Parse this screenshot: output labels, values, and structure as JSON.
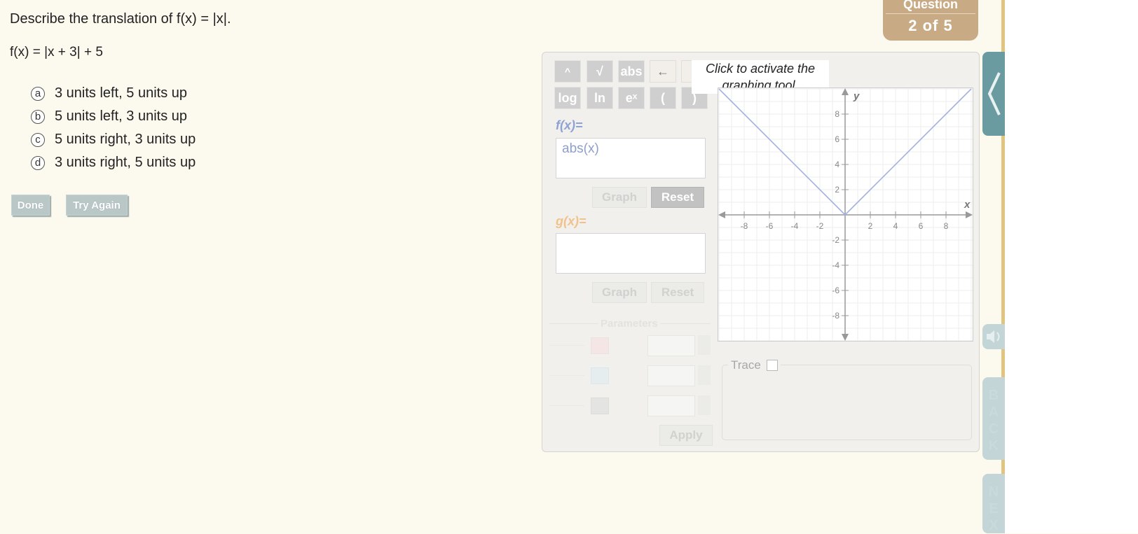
{
  "question": {
    "prompt_prefix": "Describe the translation of ",
    "prompt_fx": "f(x) = |x|.",
    "function_text": "f(x) = |x + 3| + 5",
    "choices": [
      {
        "letter": "a",
        "text": "3 units left, 5 units up"
      },
      {
        "letter": "b",
        "text": "5 units left, 3 units up"
      },
      {
        "letter": "c",
        "text": "5 units right, 3 units up"
      },
      {
        "letter": "d",
        "text": "3 units right, 5 units up"
      }
    ],
    "done_label": "Done",
    "try_again_label": "Try Again"
  },
  "badge": {
    "line1": "Question",
    "line2": "2 of 5"
  },
  "tool": {
    "keys_row1": [
      "^",
      "√",
      "abs",
      "←",
      "-"
    ],
    "keys_row2": [
      "log",
      "ln",
      "eˣ",
      "(",
      ")"
    ],
    "tooltip": "Click to activate the graphing tool.",
    "f_label": "f(x)=",
    "f_value": "abs(x)",
    "g_label": "g(x)=",
    "g_value": "",
    "graph_label": "Graph",
    "reset_label": "Reset",
    "parameters_label": "Parameters",
    "apply_label": "Apply",
    "trace_label": "Trace",
    "colors": {
      "f": "#8ea2d4",
      "g": "#f2c28b",
      "curve": "#a3b1e0"
    }
  },
  "chart_data": {
    "type": "line",
    "series": [
      {
        "values": [
          [
            -10,
            10
          ],
          [
            0,
            0
          ],
          [
            10,
            10
          ]
        ]
      }
    ],
    "xlabel": "x",
    "ylabel": "y",
    "xlim": [
      -10,
      10
    ],
    "ylim": [
      -10,
      10
    ],
    "x_ticks": [
      "-8",
      "-6",
      "-4",
      "-2",
      "2",
      "4",
      "6",
      "8"
    ],
    "y_ticks": [
      "8",
      "6",
      "4",
      "2",
      "-2",
      "-4",
      "-6",
      "-8"
    ],
    "grid": true
  },
  "side": {
    "back_letters": [
      "B",
      "A",
      "C",
      "K"
    ],
    "next_letters": [
      "N",
      "E",
      "X"
    ]
  }
}
